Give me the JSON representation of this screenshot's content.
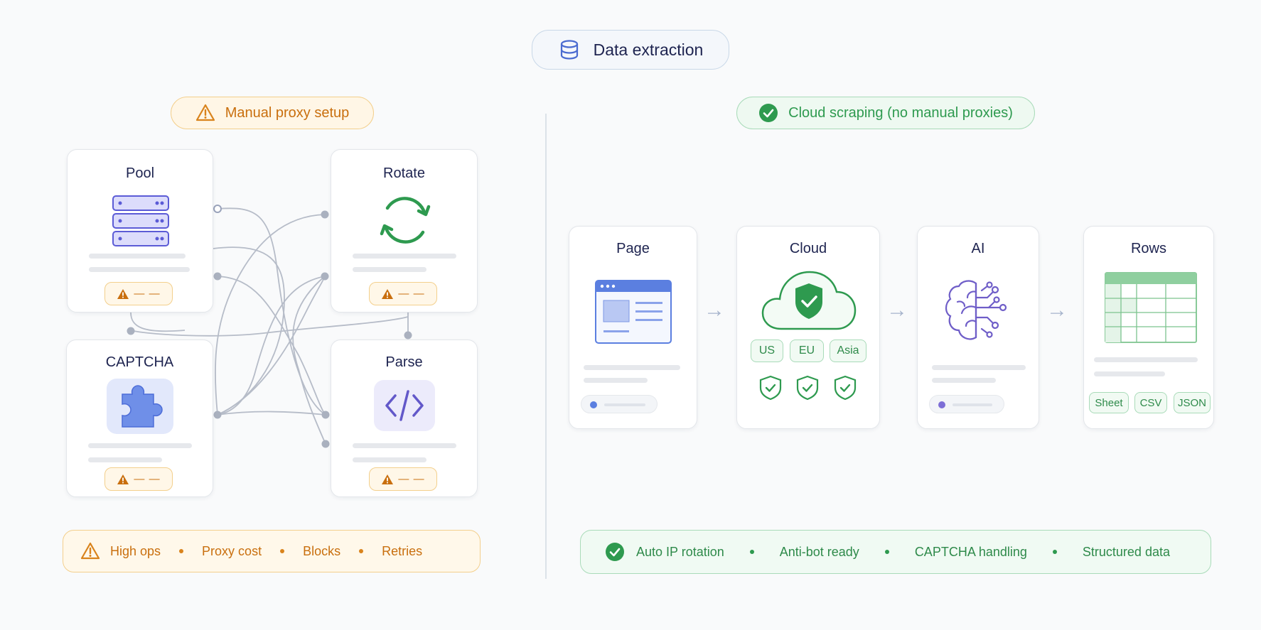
{
  "header": {
    "title": "Data extraction",
    "icon": "database-icon"
  },
  "left": {
    "badge": "Manual proxy setup",
    "cards": [
      {
        "title": "Pool",
        "icon": "server-icon"
      },
      {
        "title": "Rotate",
        "icon": "refresh-icon"
      },
      {
        "title": "CAPTCHA",
        "icon": "puzzle-icon"
      },
      {
        "title": "Parse",
        "icon": "code-icon"
      }
    ],
    "warn_dash": "— —",
    "issues": [
      "High ops",
      "Proxy cost",
      "Blocks",
      "Retries"
    ]
  },
  "right": {
    "badge": "Cloud scraping (no manual proxies)",
    "steps": [
      {
        "title": "Page",
        "icon": "browser-window-icon"
      },
      {
        "title": "Cloud",
        "icon": "cloud-shield-icon"
      },
      {
        "title": "AI",
        "icon": "ai-brain-icon"
      },
      {
        "title": "Rows",
        "icon": "spreadsheet-icon"
      }
    ],
    "regions": [
      "US",
      "EU",
      "Asia"
    ],
    "formats": [
      "Sheet",
      "CSV",
      "JSON"
    ],
    "benefits": [
      "Auto IP rotation",
      "Anti-bot ready",
      "CAPTCHA handling",
      "Structured data"
    ]
  },
  "colors": {
    "warn": "#c96f0e",
    "ok": "#2e9a4f",
    "accent": "#5b6fd6",
    "text": "#1e2450"
  }
}
